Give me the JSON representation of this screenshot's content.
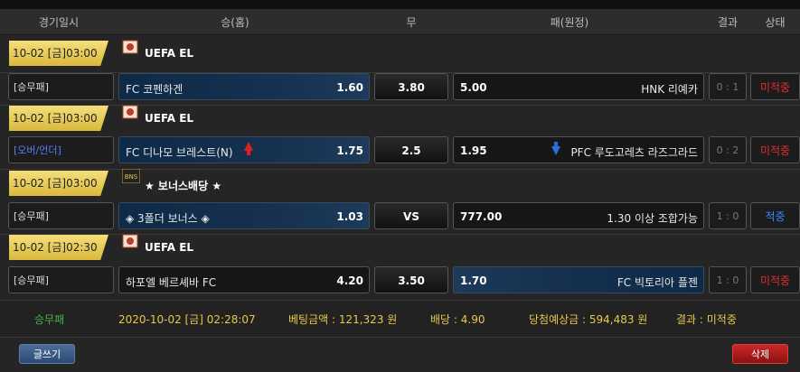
{
  "columns": {
    "date": "경기일시",
    "home": "승(홈)",
    "draw": "무",
    "away": "패(원정)",
    "result": "결과",
    "status": "상태"
  },
  "matches": [
    {
      "date": "10-02 [금]03:00",
      "league": "UEFA EL",
      "league_icon": "uefa-icon",
      "bet_type": "[승무패]",
      "home_team": "FC 코펜하겐",
      "home_odds": "1.60",
      "draw_odds": "3.80",
      "away_odds": "5.00",
      "away_team": "HNK 리예카",
      "result": "0 : 1",
      "status": "미적중"
    },
    {
      "date": "10-02 [금]03:00",
      "league": "UEFA EL",
      "league_icon": "uefa-icon",
      "bet_type": "[오버/언더]",
      "home_team": "FC 디나모 브레스트(N)",
      "home_odds": "1.75",
      "draw_odds": "2.5",
      "away_odds": "1.95",
      "away_team": "PFC 루도고레츠 라즈그라드",
      "result": "0 : 2",
      "status": "미적중"
    },
    {
      "date": "10-02 [금]03:00",
      "league": "★ 보너스배당 ★",
      "league_icon": "bonus-icon",
      "bet_type": "[승무패]",
      "home_team": "◈ 3폴더 보너스 ◈",
      "home_odds": "1.03",
      "draw_odds": "VS",
      "away_odds": "777.00",
      "away_team": "1.30 이상 조합가능",
      "result": "1 : 0",
      "status": "적중"
    },
    {
      "date": "10-02 [금]02:30",
      "league": "UEFA EL",
      "league_icon": "uefa-icon",
      "bet_type": "[승무패]",
      "home_team": "하포엘 베르셰바 FC",
      "home_odds": "4.20",
      "draw_odds": "3.50",
      "away_odds": "1.70",
      "away_team": "FC 빅토리아 플젠",
      "result": "1 : 0",
      "status": "미적중"
    }
  ],
  "summary": {
    "type": "승무패",
    "datetime": "2020-10-02 [금] 02:28:07",
    "bet_amount": "베팅금액 : 121,323 원",
    "multiplier": "배당 : 4.90",
    "expected_win": "당첨예상금 : 594,483 원",
    "result": "결과 : 미적중"
  },
  "buttons": {
    "write": "글쓰기",
    "delete": "삭제"
  },
  "colors": {
    "status_miss": "#e03030",
    "status_hit": "#3a8cff",
    "summary_label": "#e8c84a",
    "summary_type": "#4ab04a"
  }
}
